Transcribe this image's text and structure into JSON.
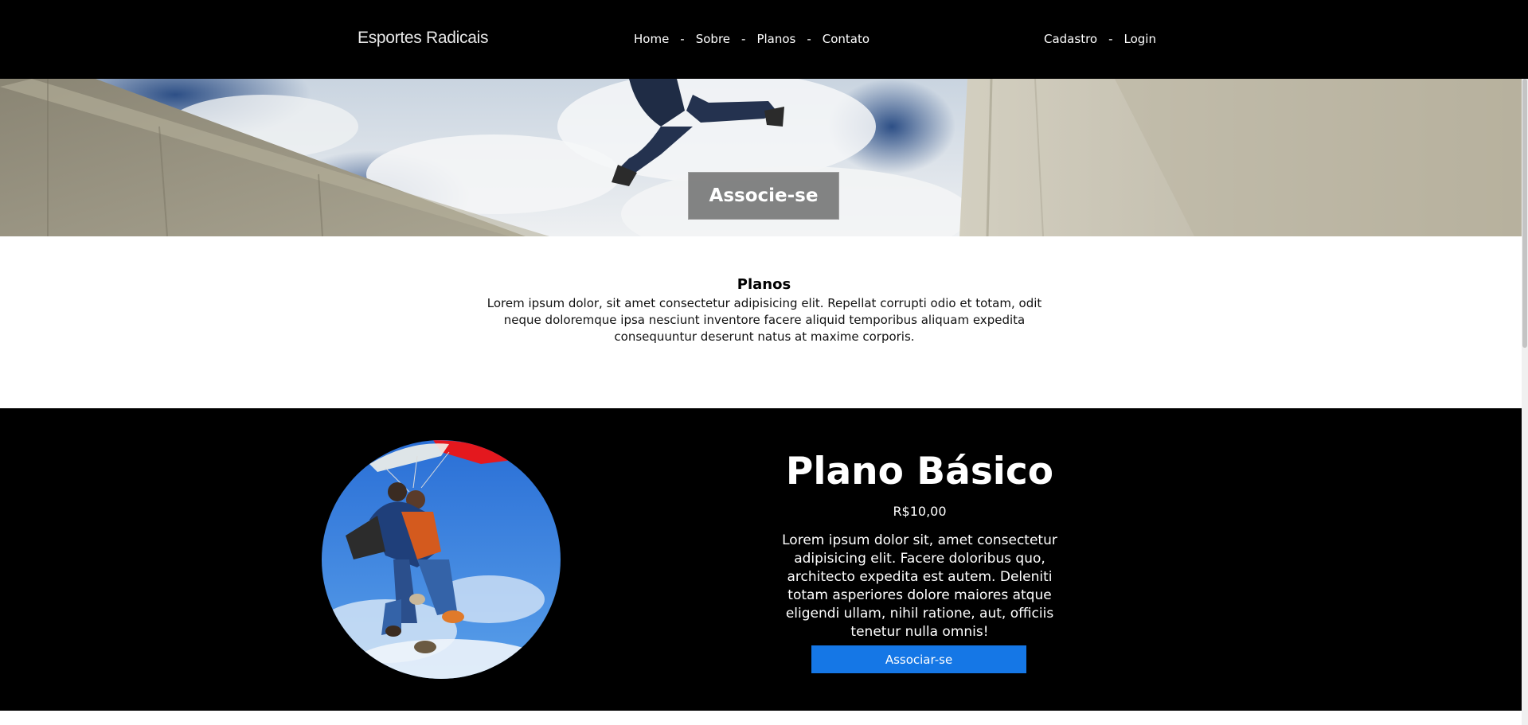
{
  "navbar": {
    "brand": "Esportes Radicais",
    "center_links": [
      "Home",
      "Sobre",
      "Planos",
      "Contato"
    ],
    "right_links": [
      "Cadastro",
      "Login"
    ],
    "separator": "-"
  },
  "hero": {
    "cta_label": "Associe-se"
  },
  "intro": {
    "title": "Planos",
    "text": "Lorem ipsum dolor, sit amet consectetur adipisicing elit. Repellat corrupti odio et totam, odit neque doloremque ipsa nesciunt inventore facere aliquid temporibus aliquam expedita consequuntur deserunt natus at maxime corporis."
  },
  "plan": {
    "title": "Plano Básico",
    "price": "R$10,00",
    "description": "Lorem ipsum dolor sit, amet consectetur adipisicing elit. Facere doloribus quo, architecto expedita est autem. Deleniti totam asperiores dolore maiores atque eligendi ullam, nihil ratione, aut, officiis tenetur nulla omnis!",
    "button_label": "Associar-se"
  },
  "colors": {
    "navbar_bg": "#000000",
    "plan_bg": "#000000",
    "button_blue": "#1577e6"
  }
}
